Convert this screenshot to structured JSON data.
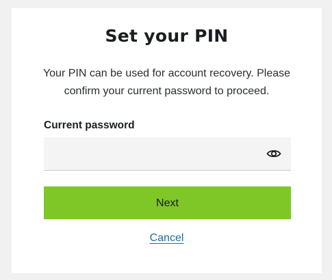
{
  "dialog": {
    "title": "Set your PIN",
    "description": "Your PIN can be used for account recovery. Please confirm your current password to proceed.",
    "password_field": {
      "label": "Current password",
      "value": "",
      "placeholder": "",
      "toggle_icon": "eye-icon"
    },
    "next_label": "Next",
    "cancel_label": "Cancel"
  },
  "colors": {
    "page_background": "#f1f1f1",
    "card_background": "#ffffff",
    "primary_button": "#7ec727",
    "link": "#1b6f9a",
    "input_background": "#f4f4f5"
  }
}
